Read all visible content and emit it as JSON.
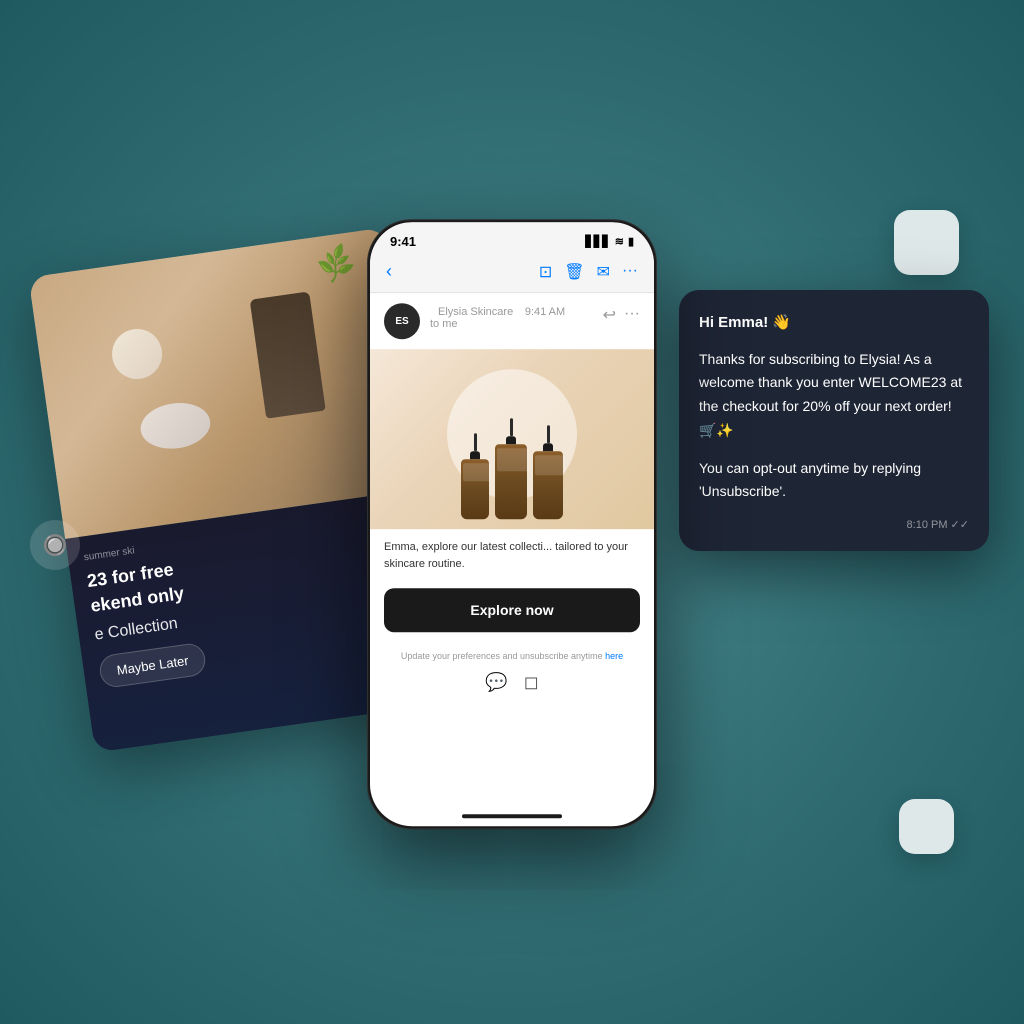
{
  "background": {
    "color": "#3d7a80"
  },
  "phone": {
    "status_time": "9:41",
    "status_signal": "▋▋▋",
    "status_wifi": "WiFi",
    "status_battery": "🔋",
    "email": {
      "sender_name": "Elysia Skincare",
      "sender_initials": "ES",
      "sender_time": "9:41 AM",
      "sender_to": "to me",
      "body_text": "Emma, explore our latest collecti... tailored to your skincare routine.",
      "cta_button": "Explore now",
      "footer_text": "Update your preferences and unsubscribe anytime",
      "footer_link": "here"
    }
  },
  "message_card": {
    "greeting": "Hi Emma! 👋",
    "line1": "Thanks for subscribing to Elysia! As a welcome thank you enter WELCOME23 at the checkout for 20% off your next order! 🛒✨",
    "line2": "You can opt-out anytime by replying 'Unsubscribe'.",
    "time": "8:10 PM ✓✓"
  },
  "skincare_card": {
    "promo_line1": "summer ski",
    "promo_line2": "23 for free",
    "promo_line3": "ekend only",
    "collection_label": "e Collection",
    "maybe_later": "Maybe Later"
  },
  "decorative": {
    "small_circle_emoji": "🔮",
    "white_squares": 2
  }
}
